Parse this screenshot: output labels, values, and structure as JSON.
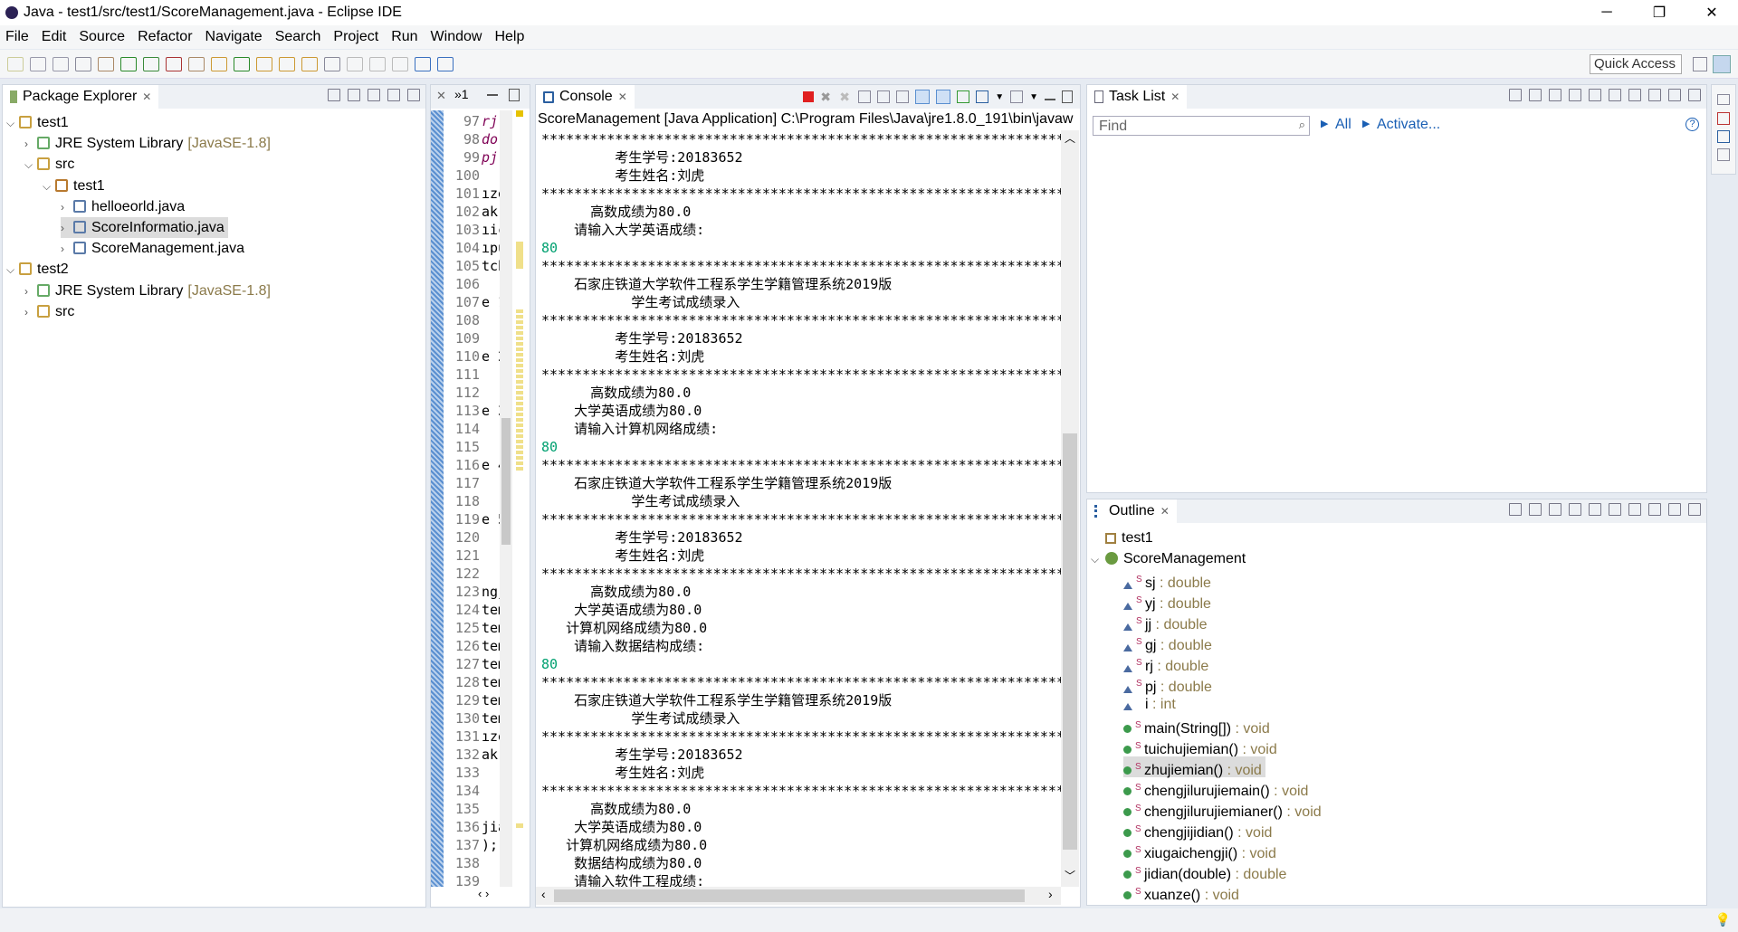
{
  "window": {
    "title": "Java - test1/src/test1/ScoreManagement.java - Eclipse IDE",
    "minimize": "─",
    "maximize": "❐",
    "close": "✕"
  },
  "menu": [
    "File",
    "Edit",
    "Source",
    "Refactor",
    "Navigate",
    "Search",
    "Project",
    "Run",
    "Window",
    "Help"
  ],
  "toolbar": {
    "quick_access": "Quick Access"
  },
  "package_explorer": {
    "title": "Package Explorer",
    "items": [
      {
        "label": "test1",
        "extra": "",
        "depth": 0,
        "expanded": true,
        "icon": "project-icon"
      },
      {
        "label": "JRE System Library",
        "extra": "[JavaSE-1.8]",
        "depth": 1,
        "expanded": false,
        "icon": "library-icon"
      },
      {
        "label": "src",
        "extra": "",
        "depth": 1,
        "expanded": true,
        "icon": "source-folder-icon"
      },
      {
        "label": "test1",
        "extra": "",
        "depth": 2,
        "expanded": true,
        "icon": "package-icon"
      },
      {
        "label": "helloeorld.java",
        "extra": "",
        "depth": 3,
        "expanded": false,
        "icon": "java-file-icon"
      },
      {
        "label": "ScoreInformatio.java",
        "extra": "",
        "depth": 3,
        "expanded": false,
        "icon": "java-file-icon",
        "selected": true
      },
      {
        "label": "ScoreManagement.java",
        "extra": "",
        "depth": 3,
        "expanded": false,
        "icon": "java-file-icon"
      },
      {
        "label": "test2",
        "extra": "",
        "depth": 0,
        "expanded": true,
        "icon": "project-icon"
      },
      {
        "label": "JRE System Library",
        "extra": "[JavaSE-1.8]",
        "depth": 1,
        "expanded": false,
        "icon": "library-icon"
      },
      {
        "label": "src",
        "extra": "",
        "depth": 1,
        "expanded": false,
        "icon": "source-folder-icon"
      }
    ]
  },
  "editor": {
    "overflow_label": "»1",
    "lines": [
      [
        "97",
        "rj"
      ],
      [
        "98",
        "do"
      ],
      [
        "99",
        "pj"
      ],
      [
        "100",
        ""
      ],
      [
        "101",
        "ıze"
      ],
      [
        "102",
        "ak;"
      ],
      [
        "103",
        "ıic"
      ],
      [
        "104",
        "ıpu"
      ],
      [
        "105",
        "tch"
      ],
      [
        "106",
        ""
      ],
      [
        "107",
        "e 1"
      ],
      [
        "108",
        ""
      ],
      [
        "109",
        ""
      ],
      [
        "110",
        "e 2"
      ],
      [
        "111",
        ""
      ],
      [
        "112",
        ""
      ],
      [
        "113",
        "e 3"
      ],
      [
        "114",
        ""
      ],
      [
        "115",
        ""
      ],
      [
        "116",
        "e 4"
      ],
      [
        "117",
        ""
      ],
      [
        "118",
        ""
      ],
      [
        "119",
        "e 5"
      ],
      [
        "120",
        ""
      ],
      [
        "121",
        ""
      ],
      [
        "122",
        ""
      ],
      [
        "123",
        "ngj"
      ],
      [
        "124",
        "tem"
      ],
      [
        "125",
        "tem"
      ],
      [
        "126",
        "tem"
      ],
      [
        "127",
        "tem"
      ],
      [
        "128",
        "tem"
      ],
      [
        "129",
        "tem"
      ],
      [
        "130",
        "tem"
      ],
      [
        "131",
        "ıze"
      ],
      [
        "132",
        "ak;"
      ],
      [
        "133",
        ""
      ],
      [
        "134",
        ""
      ],
      [
        "135",
        ""
      ],
      [
        "136",
        "jia"
      ],
      [
        "137",
        ");"
      ],
      [
        "138",
        ""
      ],
      [
        "139",
        ""
      ]
    ]
  },
  "console": {
    "title": "Console",
    "header": "ScoreManagement [Java Application] C:\\Program Files\\Java\\jre1.8.0_191\\bin\\javaw",
    "lines": [
      {
        "t": "*******************************************************************"
      },
      {
        "t": "         考生学号:20183652"
      },
      {
        "t": "         考生姓名:刘虎"
      },
      {
        "t": "********************************************************************"
      },
      {
        "t": "      高数成绩为80.0"
      },
      {
        "t": "    请输入大学英语成绩:"
      },
      {
        "t": "80",
        "input": true
      },
      {
        "t": "*******************************************************************"
      },
      {
        "t": "    石家庄铁道大学软件工程系学生学籍管理系统2019版"
      },
      {
        "t": "           学生考试成绩录入"
      },
      {
        "t": "*******************************************************************"
      },
      {
        "t": "         考生学号:20183652"
      },
      {
        "t": "         考生姓名:刘虎"
      },
      {
        "t": "********************************************************************"
      },
      {
        "t": "      高数成绩为80.0"
      },
      {
        "t": "    大学英语成绩为80.0"
      },
      {
        "t": "    请输入计算机网络成绩:"
      },
      {
        "t": "80",
        "input": true
      },
      {
        "t": "*******************************************************************"
      },
      {
        "t": "    石家庄铁道大学软件工程系学生学籍管理系统2019版"
      },
      {
        "t": "           学生考试成绩录入"
      },
      {
        "t": "*******************************************************************"
      },
      {
        "t": "         考生学号:20183652"
      },
      {
        "t": "         考生姓名:刘虎"
      },
      {
        "t": "********************************************************************"
      },
      {
        "t": "      高数成绩为80.0"
      },
      {
        "t": "    大学英语成绩为80.0"
      },
      {
        "t": "   计算机网络成绩为80.0"
      },
      {
        "t": "    请输入数据结构成绩:"
      },
      {
        "t": "80",
        "input": true
      },
      {
        "t": "*******************************************************************"
      },
      {
        "t": "    石家庄铁道大学软件工程系学生学籍管理系统2019版"
      },
      {
        "t": "           学生考试成绩录入"
      },
      {
        "t": "*******************************************************************"
      },
      {
        "t": "         考生学号:20183652"
      },
      {
        "t": "         考生姓名:刘虎"
      },
      {
        "t": "********************************************************************"
      },
      {
        "t": "      高数成绩为80.0"
      },
      {
        "t": "    大学英语成绩为80.0"
      },
      {
        "t": "   计算机网络成绩为80.0"
      },
      {
        "t": "    数据结构成绩为80.0"
      },
      {
        "t": "    请输入软件工程成绩:"
      }
    ]
  },
  "task_list": {
    "title": "Task List",
    "find_placeholder": "Find",
    "all": "All",
    "activate": "Activate..."
  },
  "outline": {
    "title": "Outline",
    "items": [
      {
        "name": "test1",
        "type": "",
        "kind": "import",
        "depth": 0
      },
      {
        "name": "ScoreManagement",
        "type": "",
        "kind": "class",
        "depth": 0,
        "expanded": true
      },
      {
        "name": "sj",
        "type": " : double",
        "kind": "field",
        "static": true,
        "depth": 1
      },
      {
        "name": "yj",
        "type": " : double",
        "kind": "field",
        "static": true,
        "depth": 1
      },
      {
        "name": "jj",
        "type": " : double",
        "kind": "field",
        "static": true,
        "depth": 1
      },
      {
        "name": "gj",
        "type": " : double",
        "kind": "field",
        "static": true,
        "depth": 1
      },
      {
        "name": "rj",
        "type": " : double",
        "kind": "field",
        "static": true,
        "depth": 1
      },
      {
        "name": "pj",
        "type": " : double",
        "kind": "field",
        "static": true,
        "depth": 1
      },
      {
        "name": "i",
        "type": " : int",
        "kind": "field",
        "static": false,
        "depth": 1
      },
      {
        "name": "main(String[])",
        "type": " : void",
        "kind": "method",
        "static": true,
        "depth": 1
      },
      {
        "name": "tuichujiemian()",
        "type": " : void",
        "kind": "method",
        "static": true,
        "depth": 1
      },
      {
        "name": "zhujiemian()",
        "type": " : void",
        "kind": "method",
        "static": true,
        "depth": 1,
        "selected": true
      },
      {
        "name": "chengjilurujiemain()",
        "type": " : void",
        "kind": "method",
        "static": true,
        "depth": 1
      },
      {
        "name": "chengjilurujiemianer()",
        "type": " : void",
        "kind": "method",
        "static": true,
        "depth": 1
      },
      {
        "name": "chengjijidian()",
        "type": " : void",
        "kind": "method",
        "static": true,
        "depth": 1
      },
      {
        "name": "xiugaichengji()",
        "type": " : void",
        "kind": "method",
        "static": true,
        "depth": 1
      },
      {
        "name": "jidian(double)",
        "type": " : double",
        "kind": "method",
        "static": true,
        "depth": 1
      },
      {
        "name": "xuanze()",
        "type": " : void",
        "kind": "method",
        "static": true,
        "depth": 1
      }
    ]
  },
  "colors": {
    "accent": "#1a5fb4",
    "console_input": "#00a070",
    "type_text": "#8b7a4a",
    "terminate": "#e02020"
  }
}
